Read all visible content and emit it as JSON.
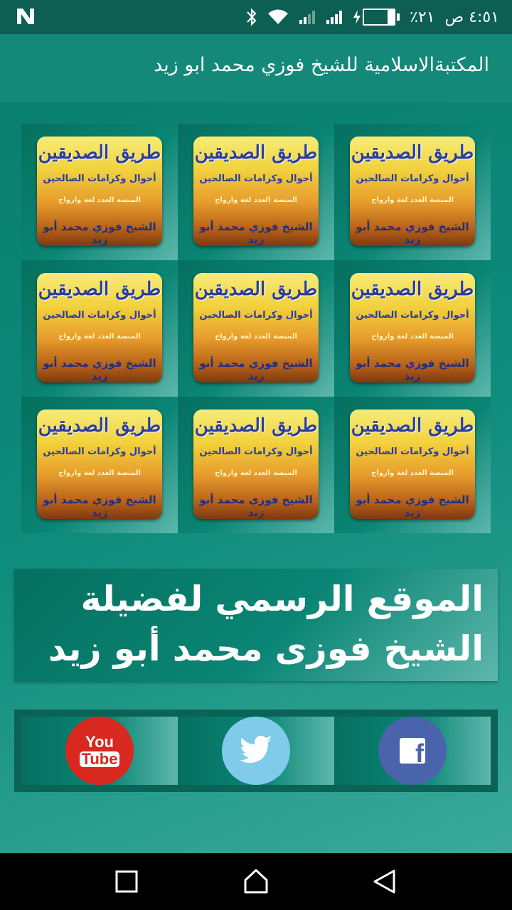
{
  "status": {
    "time": "٤:٥١ ص",
    "battery": "٪٢١",
    "battery_level": 0.21,
    "notification_icon": "n-icon"
  },
  "appbar": {
    "title": "المكتبةالاسلامية للشيخ فوزي محمد ابو زيد"
  },
  "books": [
    {
      "title": "طريق الصديقين",
      "subtitle": "أحوال وكرامات الصالحين",
      "line": "المنصة العدد لغة وارواح",
      "author": "الشيخ فوزي محمد أبو زيد"
    },
    {
      "title": "طريق الصديقين",
      "subtitle": "أحوال وكرامات الصالحين",
      "line": "المنصة العدد لغة وارواح",
      "author": "الشيخ فوزي محمد أبو زيد"
    },
    {
      "title": "طريق الصديقين",
      "subtitle": "أحوال وكرامات الصالحين",
      "line": "المنصة العدد لغة وارواح",
      "author": "الشيخ فوزي محمد أبو زيد"
    },
    {
      "title": "طريق الصديقين",
      "subtitle": "أحوال وكرامات الصالحين",
      "line": "المنصة العدد لغة وارواح",
      "author": "الشيخ فوزي محمد أبو زيد"
    },
    {
      "title": "طريق الصديقين",
      "subtitle": "أحوال وكرامات الصالحين",
      "line": "المنصة العدد لغة وارواح",
      "author": "الشيخ فوزي محمد أبو زيد"
    },
    {
      "title": "طريق الصديقين",
      "subtitle": "أحوال وكرامات الصالحين",
      "line": "المنصة العدد لغة وارواح",
      "author": "الشيخ فوزي محمد أبو زيد"
    },
    {
      "title": "طريق الصديقين",
      "subtitle": "أحوال وكرامات الصالحين",
      "line": "المنصة العدد لغة وارواح",
      "author": "الشيخ فوزي محمد أبو زيد"
    },
    {
      "title": "طريق الصديقين",
      "subtitle": "أحوال وكرامات الصالحين",
      "line": "المنصة العدد لغة وارواح",
      "author": "الشيخ فوزي محمد أبو زيد"
    },
    {
      "title": "طريق الصديقين",
      "subtitle": "أحوال وكرامات الصالحين",
      "line": "المنصة العدد لغة وارواح",
      "author": "الشيخ فوزي محمد أبو زيد"
    }
  ],
  "banner": {
    "text": "الموقع الرسمي لفضيلة الشيخ فوزى محمد أبو زيد"
  },
  "social": {
    "youtube_line1": "You",
    "youtube_line2": "Tube",
    "facebook_letter": "f",
    "icons": [
      "youtube-icon",
      "twitter-icon",
      "facebook-icon"
    ]
  },
  "navbar": {
    "icons": [
      "recents-icon",
      "home-icon",
      "back-icon"
    ]
  },
  "colors": {
    "statusbar": "#0d5f53",
    "appbar": "#14897a",
    "youtube": "#d8281f",
    "twitter": "#7fcbe9",
    "facebook": "#4a63ad"
  }
}
